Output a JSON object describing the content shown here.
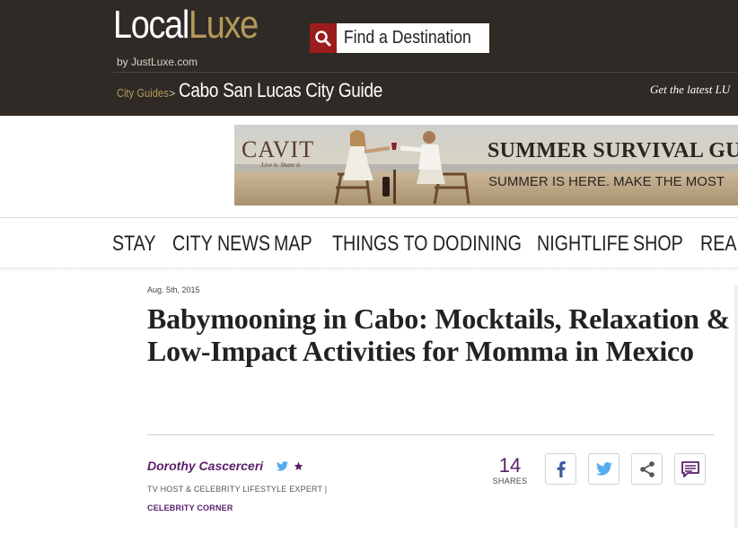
{
  "header": {
    "logo_local": "Local",
    "logo_luxe": "Luxe",
    "logo_byline": "by JustLuxe.com",
    "search_label": "Find a Destination",
    "search_icon": "search-icon",
    "breadcrumb_link": "City Guides",
    "breadcrumb_separator": ">",
    "breadcrumb_current": "Cabo San Lucas City Guide",
    "get_latest": "Get the latest LU"
  },
  "ad": {
    "brand": "CAVIT",
    "tagline": "Live it. Share it.",
    "title": "SUMMER SURVIVAL GU",
    "subtitle": "SUMMER IS HERE.  MAKE THE MOST"
  },
  "nav": {
    "items": [
      "STAY",
      "CITY NEWS",
      "MAP",
      "THINGS TO DO",
      "DINING",
      "NIGHTLIFE",
      "SHOP",
      "REAL"
    ]
  },
  "article": {
    "date": "Aug. 5th, 2015",
    "headline": "Babymooning in Cabo: Mocktails, Relaxation & Low-Impact Activities for Momma in Mexico",
    "author": "Dorothy Cascerceri",
    "author_role": "TV HOST & CELEBRITY LIFESTYLE EXPERT |",
    "author_section": "CELEBRITY CORNER",
    "share_count": "14",
    "share_label": "SHARES"
  },
  "colors": {
    "header_bg": "#2f2a25",
    "gold": "#b59a5b",
    "search_red": "#9b1c1c",
    "author_purple": "#5a1f6b",
    "facebook_blue": "#3b5998",
    "twitter_blue": "#55acee"
  }
}
